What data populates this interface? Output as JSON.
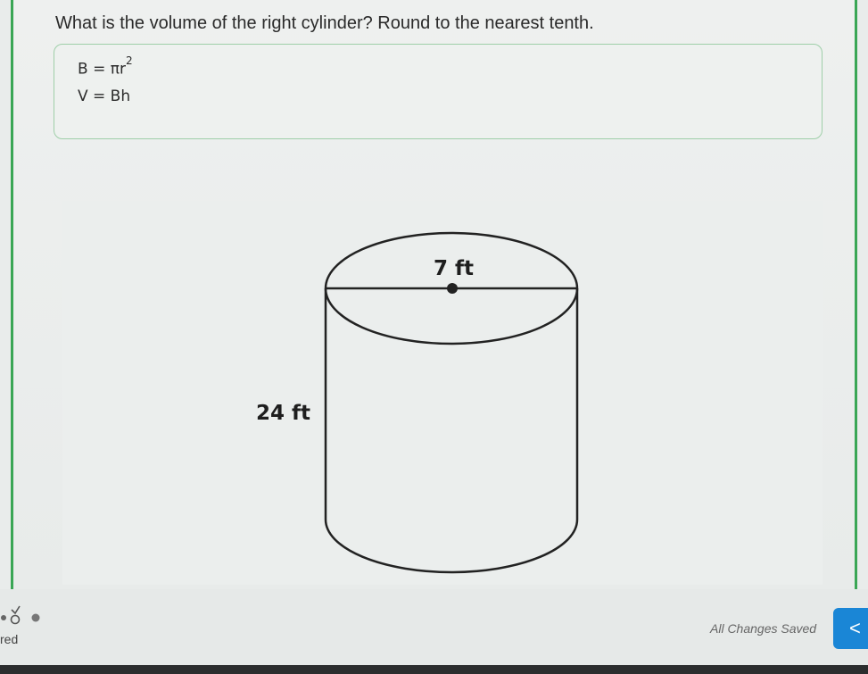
{
  "question": "What is the volume of the right cylinder? Round to the nearest tenth.",
  "formulas": {
    "base_lhs": "B = πr",
    "base_exp": "2",
    "volume": "V = Bh"
  },
  "figure": {
    "diameter_label": "7 ft",
    "height_label": "24 ft"
  },
  "footer": {
    "cut_label": "red",
    "save_status": "All Changes Saved",
    "back_glyph": "<"
  },
  "colors": {
    "accent_green": "#3aa655",
    "button_blue": "#1a86d6"
  }
}
